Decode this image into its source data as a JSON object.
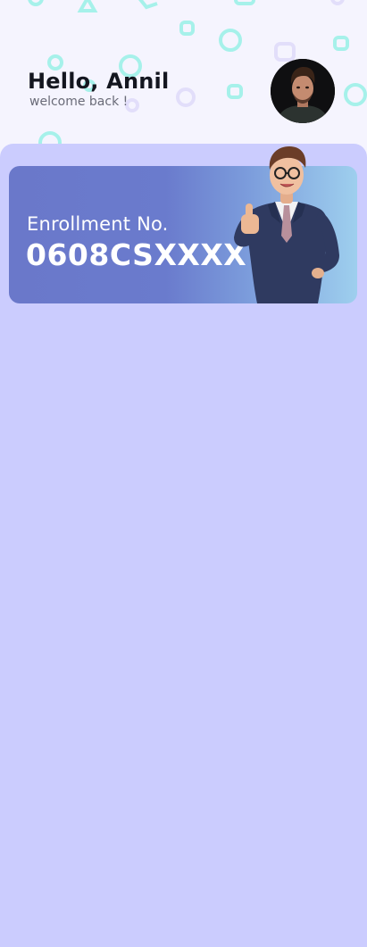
{
  "header": {
    "greeting": "Hello, Annil",
    "subtitle": "welcome back !",
    "avatar_icon": "user-avatar-photo"
  },
  "enrollment_card": {
    "label": "Enrollment No.",
    "value": "0608CSXXXX",
    "illustration_icon": "businessman-thumbs-up"
  },
  "colors": {
    "background_top": "#f5f4fe",
    "panel": "#cbccfe",
    "card_start": "#6a78ca",
    "card_end": "#9ecfee",
    "confetti": "#9ff2ea"
  }
}
